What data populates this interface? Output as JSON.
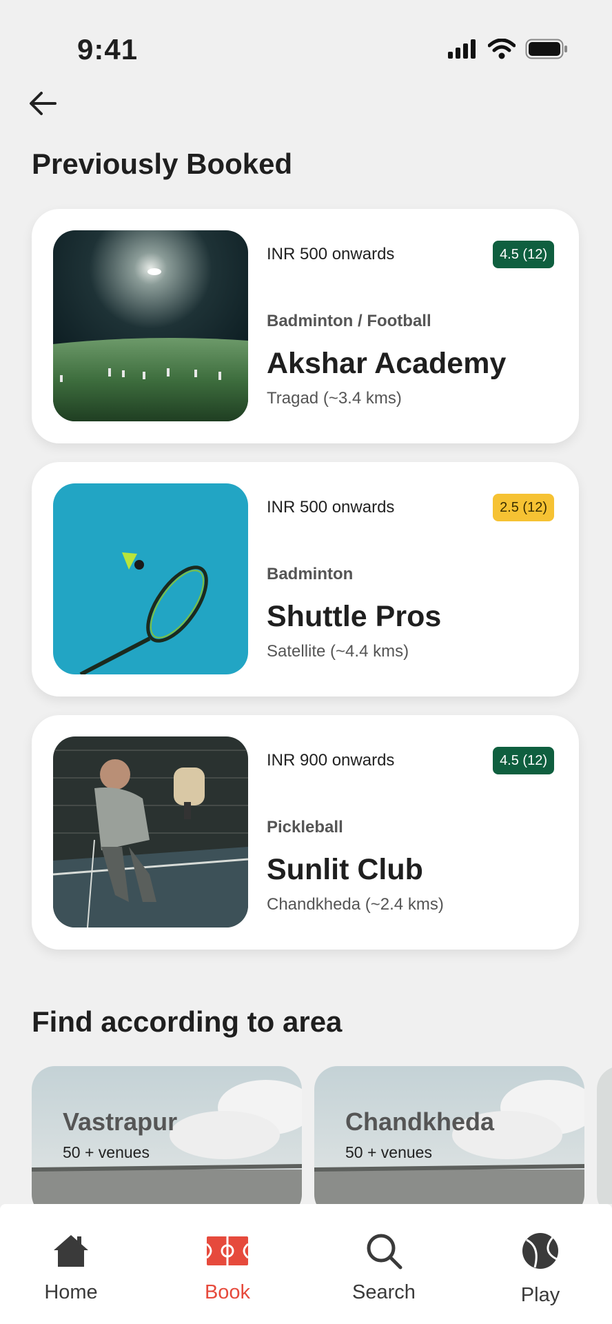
{
  "status": {
    "time": "9:41"
  },
  "sections": {
    "previously_booked": "Previously Booked",
    "find_by_area": "Find according to area"
  },
  "venues": [
    {
      "price": "INR 500 onwards",
      "rating": "4.5 (12)",
      "rating_color": "#0f5f3f",
      "sports": "Badminton / Football",
      "name": "Akshar Academy",
      "location": "Tragad (~3.4 kms)"
    },
    {
      "price": "INR 500 onwards",
      "rating": "2.5 (12)",
      "rating_color": "#f6c233",
      "sports": "Badminton",
      "name": "Shuttle Pros",
      "location": "Satellite (~4.4 kms)"
    },
    {
      "price": "INR 900 onwards",
      "rating": "4.5 (12)",
      "rating_color": "#0f5f3f",
      "sports": "Pickleball",
      "name": "Sunlit Club",
      "location": "Chandkheda (~2.4 kms)"
    }
  ],
  "areas": [
    {
      "name": "Vastrapur",
      "count": "50 + venues"
    },
    {
      "name": "Chandkheda",
      "count": "50 + venues"
    }
  ],
  "nav": {
    "items": [
      {
        "label": "Home",
        "icon": "home-icon"
      },
      {
        "label": "Book",
        "icon": "court-icon"
      },
      {
        "label": "Search",
        "icon": "search-icon"
      },
      {
        "label": "Play",
        "icon": "ball-icon"
      }
    ],
    "active": "Book",
    "active_color": "#e64a3c"
  }
}
